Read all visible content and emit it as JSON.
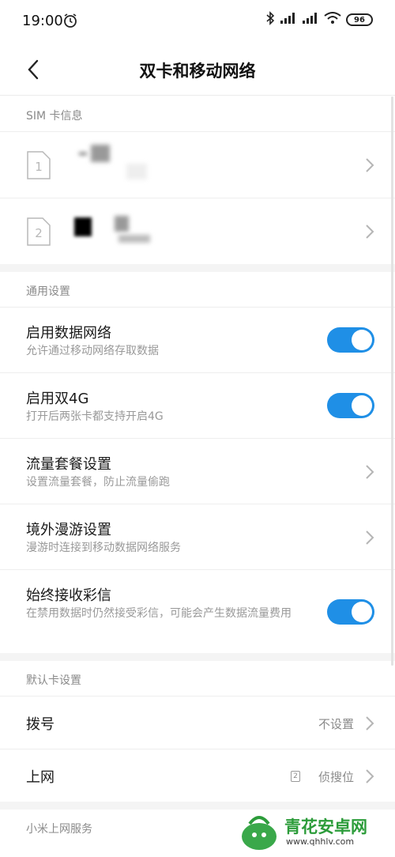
{
  "status_bar": {
    "time": "19:00",
    "battery": "96",
    "icons": [
      "alarm-icon",
      "bluetooth-icon",
      "signal-icon",
      "signal-icon",
      "wifi-icon",
      "battery-icon"
    ]
  },
  "nav": {
    "title": "双卡和移动网络",
    "back_icon": "chevron-left-icon"
  },
  "sim_section": {
    "header": "SIM 卡信息",
    "cards": [
      {
        "slot": "1"
      },
      {
        "slot": "2"
      }
    ]
  },
  "general_section": {
    "header": "通用设置",
    "items": [
      {
        "title": "启用数据网络",
        "subtitle": "允许通过移动网络存取数据",
        "control": "toggle",
        "state": "on"
      },
      {
        "title": "启用双4G",
        "subtitle": "打开后两张卡都支持开启4G",
        "control": "toggle",
        "state": "on"
      },
      {
        "title": "流量套餐设置",
        "subtitle": "设置流量套餐，防止流量偷跑",
        "control": "chevron"
      },
      {
        "title": "境外漫游设置",
        "subtitle": "漫游时连接到移动数据网络服务",
        "control": "chevron"
      },
      {
        "title": "始终接收彩信",
        "subtitle": "在禁用数据时仍然接受彩信，可能会产生数据流量费用",
        "control": "toggle",
        "state": "on"
      }
    ]
  },
  "default_card_section": {
    "header": "默认卡设置",
    "items": [
      {
        "title": "拨号",
        "value": "不设置"
      },
      {
        "title": "上网",
        "sim_badge": "2",
        "value": "侦搜位"
      }
    ]
  },
  "xiaomi_section": {
    "header": "小米上网服务"
  },
  "watermark": {
    "text": "青花安卓网",
    "url": "www.qhhlv.com"
  },
  "colors": {
    "accent": "#1f8fe6",
    "watermark_green": "#2c9c3a"
  }
}
